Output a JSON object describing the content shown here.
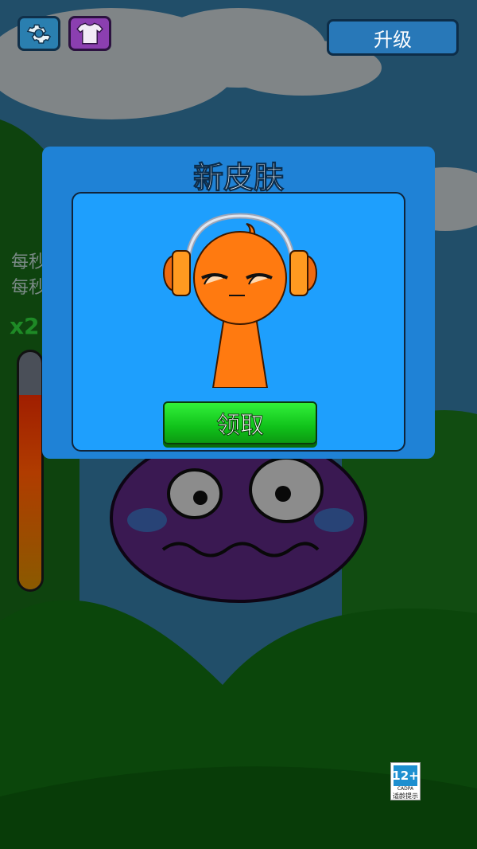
{
  "toolbar": {
    "settings_icon": "gear-icon",
    "skin_icon": "shirt-icon",
    "upgrade_label": "升级"
  },
  "stats": {
    "line1": "每秒",
    "line2": "每秒",
    "multiplier": "x2"
  },
  "meter": {
    "level": 0.82
  },
  "dialog": {
    "title": "新皮肤",
    "claim_label": "领取"
  },
  "age_rating": {
    "rating": "12+",
    "org": "CADPA",
    "note": "适龄提示"
  },
  "colors": {
    "dialog_bg": "#1f82d6",
    "panel_bg": "#1e9ffd",
    "claim_button": "#19d321",
    "character_orange": "#ff7a10",
    "monster_purple": "#5a2a7a"
  }
}
